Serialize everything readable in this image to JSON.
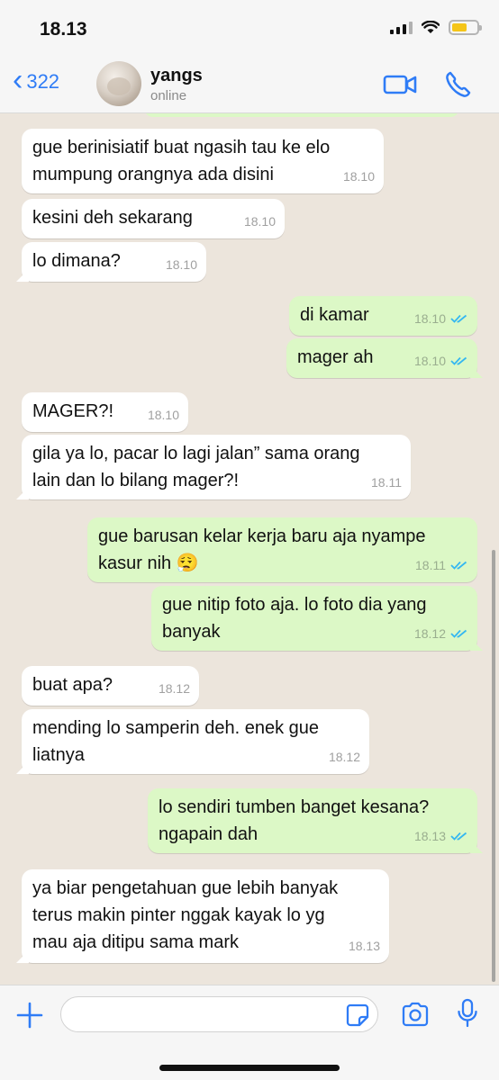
{
  "status_bar": {
    "time": "18.13"
  },
  "header": {
    "back_count": "322",
    "contact_name": "yangs",
    "contact_status": "online"
  },
  "messages": [
    {
      "dir": "in",
      "text": "gue berinisiatif buat ngasih tau ke elo\nmumpung orangnya ada disini",
      "time": "18.10"
    },
    {
      "dir": "in",
      "text": "kesini deh sekarang",
      "time": "18.10"
    },
    {
      "dir": "in",
      "text": "lo dimana?",
      "time": "18.10"
    },
    {
      "dir": "out",
      "text": "di kamar",
      "time": "18.10",
      "read": true
    },
    {
      "dir": "out",
      "text": "mager ah",
      "time": "18.10",
      "read": true
    },
    {
      "dir": "in",
      "text": "MAGER?!",
      "time": "18.10"
    },
    {
      "dir": "in",
      "text": "gila ya lo, pacar lo lagi jalan” sama orang\nlain dan lo bilang mager?!",
      "time": "18.11"
    },
    {
      "dir": "out",
      "text": "gue barusan kelar kerja baru aja nyampe\nkasur nih 😮‍💨",
      "time": "18.11",
      "read": true
    },
    {
      "dir": "out",
      "text": "gue nitip foto aja. lo foto dia yang\nbanyak",
      "time": "18.12",
      "read": true
    },
    {
      "dir": "in",
      "text": "buat apa?",
      "time": "18.12"
    },
    {
      "dir": "in",
      "text": "mending lo samperin deh. enek gue\nliatnya",
      "time": "18.12"
    },
    {
      "dir": "out",
      "text": "lo sendiri tumben banget kesana?\nngapain dah",
      "time": "18.13",
      "read": true
    },
    {
      "dir": "in",
      "text": "ya biar pengetahuan gue lebih banyak\nterus makin pinter nggak kayak lo yg\nmau aja ditipu sama mark",
      "time": "18.13"
    }
  ],
  "input": {
    "placeholder": "",
    "value": ""
  },
  "colors": {
    "accent": "#2F7CF6",
    "outgoing_bubble": "#DCF8C6",
    "incoming_bubble": "#FFFFFF",
    "chat_background": "#ECE5DC",
    "read_ticks": "#34B7F1"
  },
  "icons": [
    "chevron-left-icon",
    "video-call-icon",
    "phone-icon",
    "plus-icon",
    "sticker-icon",
    "camera-icon",
    "microphone-icon"
  ]
}
